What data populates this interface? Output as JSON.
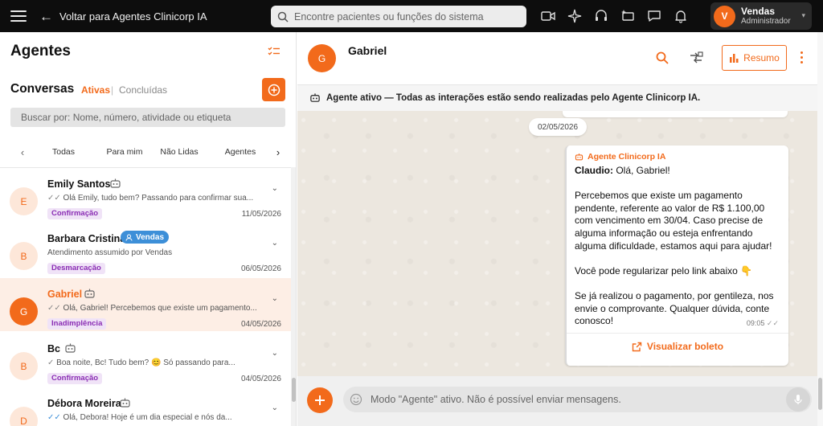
{
  "topbar": {
    "back_label": "Voltar para Agentes Clinicorp IA",
    "search_placeholder": "Encontre pacientes ou funções do sistema",
    "user_name": "Vendas",
    "user_role": "Administrador",
    "user_initial": "V"
  },
  "left": {
    "title": "Agentes",
    "conversations_title": "Conversas",
    "tab_active": "Ativas",
    "tab_separator": "|",
    "tab_done": "Concluídas",
    "search_placeholder": "Buscar por: Nome, número, atividade ou etiqueta",
    "filters": [
      "Todas",
      "Para mim",
      "Não Lidas",
      "Agentes"
    ],
    "conversations": [
      {
        "initial": "E",
        "name": "Emily Santos",
        "preview": "Olá Emily, tudo bem? Passando para confirmar sua...",
        "tag": "Confirmação",
        "date": "11/05/2026"
      },
      {
        "initial": "B",
        "name": "Barbara Cristina",
        "badge": "Vendas",
        "preview": "Atendimento assumido por Vendas",
        "tag": "Desmarcação",
        "date": "06/05/2026"
      },
      {
        "initial": "G",
        "name": "Gabriel",
        "preview": "Olá, Gabriel! Percebemos que existe um pagamento...",
        "tag": "Inadimplência",
        "date": "04/05/2026"
      },
      {
        "initial": "B",
        "name": "Bc",
        "preview": "Boa noite, Bc! Tudo bem? 😊 Só passando para...",
        "tag": "Confirmação",
        "date": "04/05/2026"
      },
      {
        "initial": "D",
        "name": "Débora Moreira",
        "preview": "Olá, Debora! Hoje é um dia especial e nós da...",
        "tag": "",
        "date": ""
      }
    ]
  },
  "chat": {
    "contact_name": "Gabriel",
    "contact_initial": "G",
    "resumo_label": "Resumo",
    "agent_notice": "Agente ativo — Todas as interações estão sendo realizadas pelo Agente Clinicorp IA.",
    "date_pill": "02/05/2026",
    "message": {
      "sender": "Agente Clinicorp IA",
      "author": "Claudio:",
      "text": " Olá, Gabriel!\n\nPercebemos que existe um pagamento pendente, referente ao valor de R$ 1.100,00 com vencimento em 30/04. Caso precise de alguma informação ou esteja enfrentando alguma dificuldade, estamos aqui para ajudar!\n\nVocê pode regularizar pelo link abaixo 👇\n\nSe já realizou o pagamento, por gentileza, nos envie o comprovante. Qualquer dúvida, conte conosco!",
      "time": "09:05",
      "link_label": "Visualizar boleto"
    },
    "input_placeholder": "Modo \"Agente\" ativo. Não é possível enviar mensagens."
  },
  "colors": {
    "accent": "#f26a1b",
    "tag_bg": "#f0e3f7",
    "tag_text": "#8a2db4",
    "badge_blue": "#3d8fd8"
  }
}
